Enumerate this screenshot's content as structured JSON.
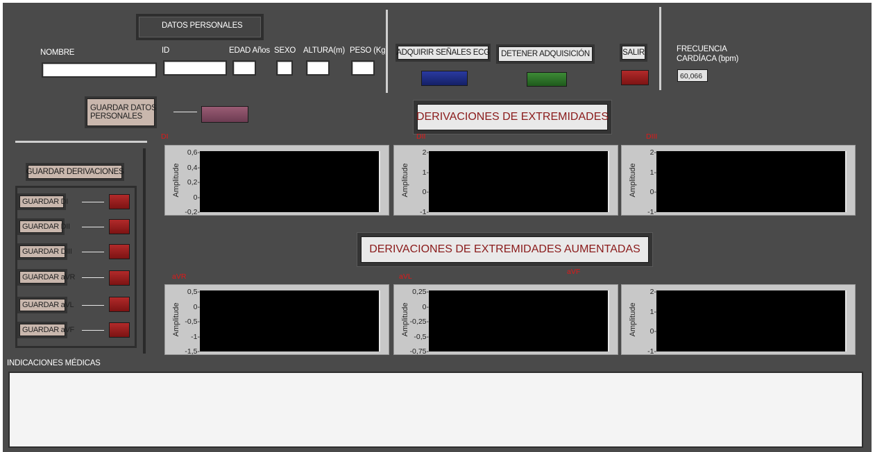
{
  "personal": {
    "header": "DATOS PERSONALES",
    "nombre_label": "NOMBRE",
    "id_label": "ID",
    "edad_label": "EDAD Años",
    "sexo_label": "SEXO",
    "altura_label": "ALTURA(m)",
    "peso_label": "PESO (Kg)",
    "save_label_line1": "GUARDAR DATOS",
    "save_label_line2": "PERSONALES"
  },
  "acquisition": {
    "adquirir_label": "ADQUIRIR SEÑALES ECG",
    "detener_label": "DETENER ADQUISICIÓN",
    "salir_label": "SALIR"
  },
  "heart_rate": {
    "label_line1": "FRECUENCIA",
    "label_line2": "CARDÍACA  (bpm)",
    "value": "60,066"
  },
  "sections": {
    "limb_title": "DERIVACIONES DE EXTREMIDADES",
    "augmented_title": "DERIVACIONES DE EXTREMIDADES AUMENTADAS"
  },
  "save_leads": {
    "title": "GUARDAR DERIVACIONES",
    "items": [
      {
        "label": "GUARDAR DI"
      },
      {
        "label": "GUARDAR DII"
      },
      {
        "label": "GUARDAR DIII"
      },
      {
        "label": "GUARDAR aVR"
      },
      {
        "label": "GUARDAR aVL"
      },
      {
        "label": "GUARDAR aVF"
      }
    ]
  },
  "graphs": {
    "y_label": "Amplitude",
    "items": [
      {
        "name": "DI",
        "ticks": [
          "0,6-",
          "0,4-",
          "0,2-",
          "0-",
          "-0,2-"
        ]
      },
      {
        "name": "DII",
        "ticks": [
          "2-",
          "1-",
          "0-",
          "-1-"
        ]
      },
      {
        "name": "DIII",
        "ticks": [
          "2-",
          "1-",
          "0-",
          "-1-"
        ]
      },
      {
        "name": "aVR",
        "ticks": [
          "0,5-",
          "0-",
          "-0,5-",
          "-1-",
          "-1,5-"
        ]
      },
      {
        "name": "aVL",
        "ticks": [
          "0,25-",
          "0-",
          "-0,25-",
          "-0,5-",
          "-0,75-"
        ]
      },
      {
        "name": "aVF",
        "ticks": [
          "2-",
          "1-",
          "0-",
          "-1-"
        ]
      }
    ]
  },
  "notes": {
    "label": "INDICACIONES  MÉDICAS",
    "value": ""
  },
  "colors": {
    "panel": "#4a4a4a",
    "graph_name": "#e01818",
    "section_title": "#8a1a1a",
    "led_red": "#9a1e1e",
    "led_blue": "#1e2c86",
    "led_green": "#2e7228",
    "led_mauve": "#844c62"
  }
}
